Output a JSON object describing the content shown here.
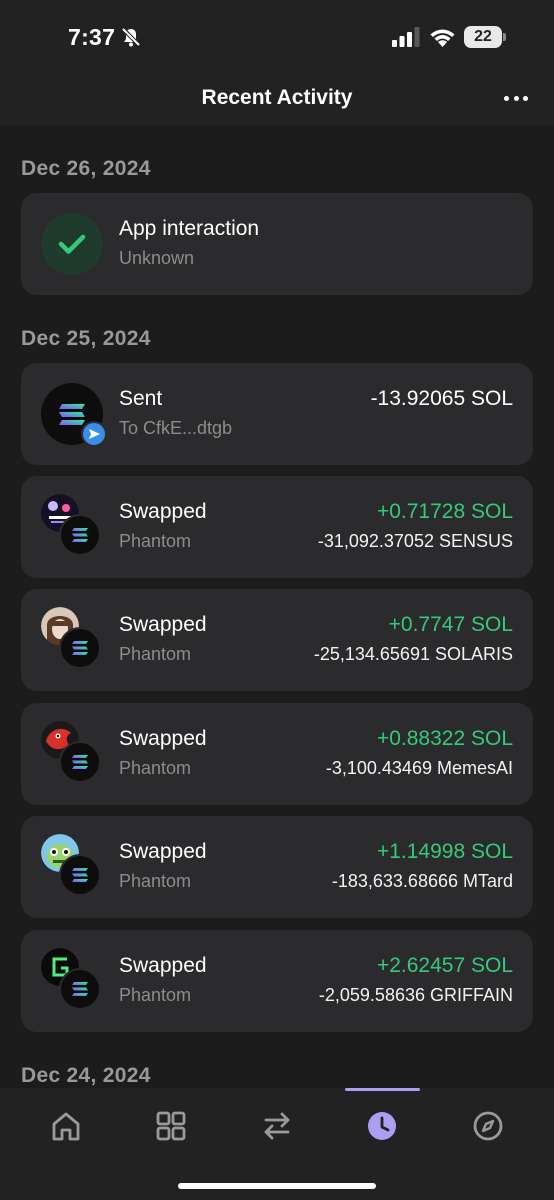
{
  "status": {
    "time": "7:37",
    "battery": "22"
  },
  "header": {
    "title": "Recent Activity"
  },
  "groups": [
    {
      "date": "Dec 26, 2024",
      "items": [
        {
          "title": "App interaction",
          "subtitle": "Unknown",
          "icon": "check-icon"
        }
      ]
    },
    {
      "date": "Dec 25, 2024",
      "items": [
        {
          "title": "Sent",
          "subtitle": "To CfkE...dtgb",
          "amount": "-13.92065 SOL",
          "icon": "solana-icon"
        },
        {
          "title": "Swapped",
          "subtitle": "Phantom",
          "amount_in": "+0.71728 SOL",
          "amount_out": "-31,092.37052 SENSUS",
          "token_icon": "sensus-token-icon"
        },
        {
          "title": "Swapped",
          "subtitle": "Phantom",
          "amount_in": "+0.7747 SOL",
          "amount_out": "-25,134.65691 SOLARIS",
          "token_icon": "solaris-token-icon"
        },
        {
          "title": "Swapped",
          "subtitle": "Phantom",
          "amount_in": "+0.88322 SOL",
          "amount_out": "-3,100.43469 MemesAI",
          "token_icon": "memesai-token-icon"
        },
        {
          "title": "Swapped",
          "subtitle": "Phantom",
          "amount_in": "+1.14998 SOL",
          "amount_out": "-183,633.68666 MTard",
          "token_icon": "mtard-token-icon"
        },
        {
          "title": "Swapped",
          "subtitle": "Phantom",
          "amount_in": "+2.62457 SOL",
          "amount_out": "-2,059.58636 GRIFFAIN",
          "token_icon": "griffain-token-icon"
        }
      ]
    },
    {
      "date": "Dec 24, 2024",
      "items": []
    }
  ],
  "tabs": [
    {
      "name": "home-icon",
      "active": false
    },
    {
      "name": "grid-icon",
      "active": false
    },
    {
      "name": "swap-icon",
      "active": false
    },
    {
      "name": "clock-icon",
      "active": true
    },
    {
      "name": "compass-icon",
      "active": false
    }
  ],
  "colors": {
    "background": "#1c1c1c",
    "card": "#2b2b2d",
    "positive": "#35c97a",
    "accent": "#ab9ff2",
    "muted": "#8c8c8c"
  }
}
